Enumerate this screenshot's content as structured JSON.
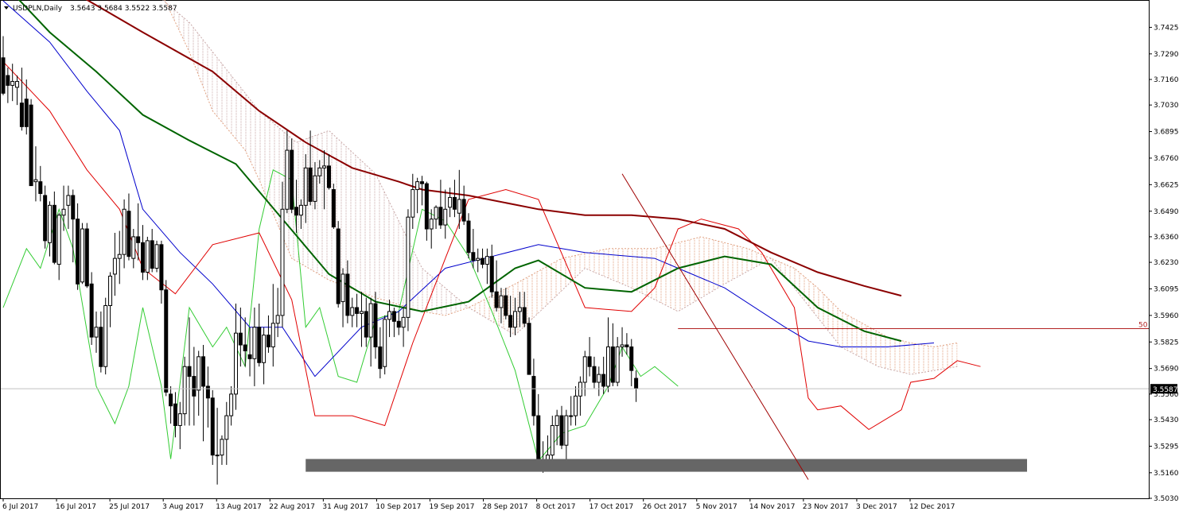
{
  "header": {
    "symbol": "USDPLN,Daily",
    "ohlc": "3.5643 3.5684 3.5522 3.5587"
  },
  "current_price_label": "3.5587",
  "fib_label": "50",
  "colors": {
    "bull_candle": "#ffffff",
    "bear_candle": "#000000",
    "ma_long": "#8b0000",
    "ma_mid": "#006400",
    "tenkan": "#e00000",
    "kijun": "#0000cc",
    "chikou": "#33cc33",
    "kumo_up": "#e0a080",
    "kumo_down": "#c8a8a8",
    "fib_line": "#b22222",
    "support_zone": "#666666"
  },
  "chart_data": {
    "type": "candlestick",
    "instrument": "USDPLN",
    "timeframe": "Daily",
    "last_ohlc": {
      "open": 3.5643,
      "high": 3.5684,
      "low": 3.5522,
      "close": 3.5587
    },
    "ylim": [
      3.503,
      3.756
    ],
    "y_ticks": [
      "3.7425",
      "3.7290",
      "3.7160",
      "3.7030",
      "3.6895",
      "3.6760",
      "3.6625",
      "3.6490",
      "3.6360",
      "3.6230",
      "3.6095",
      "3.5960",
      "3.5825",
      "3.5690",
      "3.5560",
      "3.5430",
      "3.5295",
      "3.5160",
      "3.5030"
    ],
    "x_ticks": [
      "6 Jul 2017",
      "16 Jul 2017",
      "25 Jul 2017",
      "3 Aug 2017",
      "13 Aug 2017",
      "22 Aug 2017",
      "31 Aug 2017",
      "10 Sep 2017",
      "19 Sep 2017",
      "28 Sep 2017",
      "8 Oct 2017",
      "17 Oct 2017",
      "26 Oct 2017",
      "5 Nov 2017",
      "14 Nov 2017",
      "23 Nov 2017",
      "3 Dec 2017",
      "12 Dec 2017"
    ],
    "candles": [
      [
        3.727,
        3.738,
        3.708,
        3.709
      ],
      [
        3.718,
        3.722,
        3.704,
        3.713
      ],
      [
        3.713,
        3.724,
        3.705,
        3.715
      ],
      [
        3.712,
        3.718,
        3.703,
        3.715
      ],
      [
        3.704,
        3.722,
        3.69,
        3.692
      ],
      [
        3.706,
        3.716,
        3.688,
        3.692
      ],
      [
        3.703,
        3.706,
        3.662,
        3.662
      ],
      [
        3.664,
        3.682,
        3.654,
        3.665
      ],
      [
        3.664,
        3.672,
        3.654,
        3.658
      ],
      [
        3.657,
        3.662,
        3.63,
        3.634
      ],
      [
        3.633,
        3.654,
        3.626,
        3.652
      ],
      [
        3.652,
        3.659,
        3.622,
        3.623
      ],
      [
        3.622,
        3.648,
        3.614,
        3.647
      ],
      [
        3.647,
        3.662,
        3.639,
        3.65
      ],
      [
        3.652,
        3.662,
        3.64,
        3.657
      ],
      [
        3.657,
        3.66,
        3.623,
        3.645
      ],
      [
        3.645,
        3.653,
        3.609,
        3.612
      ],
      [
        3.613,
        3.643,
        3.612,
        3.64
      ],
      [
        3.64,
        3.643,
        3.61,
        3.611
      ],
      [
        3.612,
        3.618,
        3.581,
        3.585
      ],
      [
        3.585,
        3.598,
        3.577,
        3.59
      ],
      [
        3.59,
        3.598,
        3.567,
        3.57
      ],
      [
        3.57,
        3.605,
        3.566,
        3.601
      ],
      [
        3.601,
        3.618,
        3.59,
        3.616
      ],
      [
        3.617,
        3.638,
        3.606,
        3.625
      ],
      [
        3.625,
        3.639,
        3.612,
        3.627
      ],
      [
        3.627,
        3.655,
        3.62,
        3.65
      ],
      [
        3.649,
        3.658,
        3.624,
        3.626
      ],
      [
        3.625,
        3.64,
        3.62,
        3.636
      ],
      [
        3.636,
        3.653,
        3.624,
        3.633
      ],
      [
        3.633,
        3.642,
        3.614,
        3.618
      ],
      [
        3.618,
        3.636,
        3.614,
        3.634
      ],
      [
        3.634,
        3.64,
        3.618,
        3.62
      ],
      [
        3.62,
        3.634,
        3.618,
        3.632
      ],
      [
        3.632,
        3.634,
        3.602,
        3.609
      ],
      [
        3.609,
        3.614,
        3.555,
        3.557
      ],
      [
        3.556,
        3.56,
        3.541,
        3.55
      ],
      [
        3.551,
        3.557,
        3.534,
        3.54
      ],
      [
        3.54,
        3.552,
        3.528,
        3.546
      ],
      [
        3.546,
        3.575,
        3.54,
        3.57
      ],
      [
        3.57,
        3.595,
        3.54,
        3.565
      ],
      [
        3.565,
        3.58,
        3.54,
        3.555
      ],
      [
        3.558,
        3.578,
        3.545,
        3.575
      ],
      [
        3.575,
        3.581,
        3.532,
        3.56
      ],
      [
        3.56,
        3.57,
        3.539,
        3.554
      ],
      [
        3.554,
        3.558,
        3.52,
        3.525
      ],
      [
        3.525,
        3.549,
        3.51,
        3.525
      ],
      [
        3.525,
        3.535,
        3.52,
        3.533
      ],
      [
        3.533,
        3.552,
        3.52,
        3.545
      ],
      [
        3.545,
        3.56,
        3.54,
        3.556
      ],
      [
        3.556,
        3.602,
        3.548,
        3.587
      ],
      [
        3.587,
        3.6,
        3.57,
        3.581
      ],
      [
        3.581,
        3.595,
        3.57,
        3.578
      ],
      [
        3.576,
        3.59,
        3.565,
        3.574
      ],
      [
        3.574,
        3.6,
        3.56,
        3.59
      ],
      [
        3.59,
        3.602,
        3.57,
        3.572
      ],
      [
        3.572,
        3.59,
        3.561,
        3.586
      ],
      [
        3.586,
        3.596,
        3.577,
        3.58
      ],
      [
        3.58,
        3.612,
        3.57,
        3.592
      ],
      [
        3.592,
        3.61,
        3.585,
        3.596
      ],
      [
        3.596,
        3.664,
        3.59,
        3.65
      ],
      [
        3.65,
        3.69,
        3.648,
        3.68
      ],
      [
        3.68,
        3.686,
        3.648,
        3.65
      ],
      [
        3.651,
        3.665,
        3.638,
        3.647
      ],
      [
        3.647,
        3.655,
        3.64,
        3.652
      ],
      [
        3.652,
        3.678,
        3.643,
        3.671
      ],
      [
        3.671,
        3.69,
        3.652,
        3.654
      ],
      [
        3.654,
        3.674,
        3.65,
        3.667
      ],
      [
        3.667,
        3.675,
        3.663,
        3.671
      ],
      [
        3.671,
        3.68,
        3.65,
        3.672
      ],
      [
        3.672,
        3.678,
        3.66,
        3.661
      ],
      [
        3.66,
        3.663,
        3.64,
        3.641
      ],
      [
        3.64,
        3.644,
        3.6,
        3.602
      ],
      [
        3.603,
        3.62,
        3.59,
        3.617
      ],
      [
        3.617,
        3.624,
        3.592,
        3.596
      ],
      [
        3.596,
        3.605,
        3.59,
        3.6
      ],
      [
        3.6,
        3.607,
        3.59,
        3.597
      ],
      [
        3.597,
        3.608,
        3.58,
        3.598
      ],
      [
        3.598,
        3.605,
        3.58,
        3.585
      ],
      [
        3.585,
        3.605,
        3.57,
        3.602
      ],
      [
        3.602,
        3.608,
        3.574,
        3.58
      ],
      [
        3.58,
        3.59,
        3.564,
        3.569
      ],
      [
        3.57,
        3.596,
        3.566,
        3.594
      ],
      [
        3.594,
        3.604,
        3.585,
        3.598
      ],
      [
        3.598,
        3.6,
        3.585,
        3.593
      ],
      [
        3.593,
        3.598,
        3.586,
        3.59
      ],
      [
        3.59,
        3.6,
        3.58,
        3.595
      ],
      [
        3.595,
        3.65,
        3.588,
        3.646
      ],
      [
        3.646,
        3.668,
        3.64,
        3.66
      ],
      [
        3.66,
        3.666,
        3.648,
        3.664
      ],
      [
        3.664,
        3.667,
        3.652,
        3.663
      ],
      [
        3.663,
        3.664,
        3.634,
        3.64
      ],
      [
        3.64,
        3.65,
        3.63,
        3.645
      ],
      [
        3.645,
        3.652,
        3.64,
        3.651
      ],
      [
        3.651,
        3.665,
        3.64,
        3.642
      ],
      [
        3.642,
        3.66,
        3.635,
        3.65
      ],
      [
        3.651,
        3.661,
        3.646,
        3.656
      ],
      [
        3.656,
        3.665,
        3.646,
        3.65
      ],
      [
        3.648,
        3.67,
        3.64,
        3.655
      ],
      [
        3.655,
        3.662,
        3.642,
        3.644
      ],
      [
        3.644,
        3.648,
        3.625,
        3.628
      ],
      [
        3.628,
        3.64,
        3.62,
        3.624
      ],
      [
        3.624,
        3.63,
        3.618,
        3.625
      ],
      [
        3.625,
        3.63,
        3.62,
        3.622
      ],
      [
        3.622,
        3.63,
        3.612,
        3.626
      ],
      [
        3.626,
        3.632,
        3.605,
        3.608
      ],
      [
        3.608,
        3.624,
        3.598,
        3.6
      ],
      [
        3.6,
        3.61,
        3.592,
        3.606
      ],
      [
        3.606,
        3.61,
        3.594,
        3.596
      ],
      [
        3.596,
        3.606,
        3.585,
        3.59
      ],
      [
        3.59,
        3.605,
        3.586,
        3.598
      ],
      [
        3.598,
        3.608,
        3.59,
        3.6
      ],
      [
        3.6,
        3.608,
        3.59,
        3.592
      ],
      [
        3.592,
        3.595,
        3.568,
        3.566
      ],
      [
        3.565,
        3.574,
        3.54,
        3.545
      ],
      [
        3.545,
        3.556,
        3.524,
        3.522
      ],
      [
        3.52,
        3.532,
        3.516,
        3.522
      ],
      [
        3.522,
        3.535,
        3.518,
        3.525
      ],
      [
        3.525,
        3.545,
        3.52,
        3.54
      ],
      [
        3.54,
        3.548,
        3.53,
        3.545
      ],
      [
        3.545,
        3.55,
        3.528,
        3.53
      ],
      [
        3.53,
        3.548,
        3.518,
        3.545
      ],
      [
        3.545,
        3.555,
        3.54,
        3.545
      ],
      [
        3.545,
        3.56,
        3.54,
        3.555
      ],
      [
        3.555,
        3.565,
        3.545,
        3.562
      ],
      [
        3.562,
        3.578,
        3.555,
        3.575
      ],
      [
        3.575,
        3.585,
        3.565,
        3.57
      ],
      [
        3.57,
        3.575,
        3.559,
        3.562
      ],
      [
        3.562,
        3.57,
        3.555,
        3.566
      ],
      [
        3.566,
        3.575,
        3.556,
        3.56
      ],
      [
        3.56,
        3.595,
        3.557,
        3.58
      ],
      [
        3.58,
        3.592,
        3.56,
        3.562
      ],
      [
        3.562,
        3.585,
        3.56,
        3.58
      ],
      [
        3.58,
        3.59,
        3.575,
        3.581
      ],
      [
        3.581,
        3.587,
        3.576,
        3.58
      ],
      [
        3.58,
        3.584,
        3.56,
        3.568
      ],
      [
        3.564,
        3.568,
        3.552,
        3.559
      ]
    ],
    "ma_long": [
      [
        0,
        3.772
      ],
      [
        14,
        3.762
      ],
      [
        30,
        3.74
      ],
      [
        45,
        3.72
      ],
      [
        55,
        3.7
      ],
      [
        65,
        3.684
      ],
      [
        75,
        3.671
      ],
      [
        85,
        3.664
      ],
      [
        90,
        3.66
      ],
      [
        100,
        3.657
      ],
      [
        115,
        3.65
      ],
      [
        125,
        3.647
      ],
      [
        135,
        3.647
      ],
      [
        145,
        3.645
      ],
      [
        155,
        3.64
      ],
      [
        165,
        3.628
      ],
      [
        175,
        3.618
      ],
      [
        185,
        3.611
      ],
      [
        193,
        3.606
      ]
    ],
    "ma_mid": [
      [
        0,
        3.765
      ],
      [
        10,
        3.74
      ],
      [
        20,
        3.72
      ],
      [
        30,
        3.698
      ],
      [
        40,
        3.685
      ],
      [
        50,
        3.673
      ],
      [
        60,
        3.645
      ],
      [
        70,
        3.617
      ],
      [
        80,
        3.603
      ],
      [
        90,
        3.598
      ],
      [
        100,
        3.603
      ],
      [
        110,
        3.62
      ],
      [
        115,
        3.624
      ],
      [
        125,
        3.61
      ],
      [
        135,
        3.608
      ],
      [
        145,
        3.62
      ],
      [
        155,
        3.626
      ],
      [
        165,
        3.622
      ],
      [
        175,
        3.6
      ],
      [
        185,
        3.588
      ],
      [
        193,
        3.583
      ]
    ],
    "tenkan": [
      [
        0,
        3.725
      ],
      [
        10,
        3.7
      ],
      [
        18,
        3.67
      ],
      [
        25,
        3.65
      ],
      [
        30,
        3.62
      ],
      [
        37,
        3.607
      ],
      [
        45,
        3.632
      ],
      [
        55,
        3.638
      ],
      [
        62,
        3.604
      ],
      [
        67,
        3.545
      ],
      [
        75,
        3.545
      ],
      [
        82,
        3.54
      ],
      [
        88,
        3.582
      ],
      [
        95,
        3.625
      ],
      [
        100,
        3.655
      ],
      [
        108,
        3.66
      ],
      [
        115,
        3.655
      ],
      [
        125,
        3.6
      ],
      [
        135,
        3.598
      ],
      [
        140,
        3.61
      ],
      [
        145,
        3.64
      ],
      [
        150,
        3.645
      ],
      [
        158,
        3.64
      ],
      [
        163,
        3.628
      ],
      [
        170,
        3.6
      ],
      [
        173,
        3.554
      ],
      [
        175,
        3.548
      ],
      [
        180,
        3.55
      ],
      [
        186,
        3.538
      ],
      [
        193,
        3.548
      ],
      [
        195,
        3.562
      ],
      [
        200,
        3.564
      ],
      [
        205,
        3.573
      ],
      [
        210,
        3.57
      ]
    ],
    "kijun": [
      [
        0,
        3.756
      ],
      [
        10,
        3.735
      ],
      [
        18,
        3.71
      ],
      [
        25,
        3.69
      ],
      [
        30,
        3.65
      ],
      [
        38,
        3.628
      ],
      [
        45,
        3.612
      ],
      [
        53,
        3.59
      ],
      [
        60,
        3.59
      ],
      [
        67,
        3.565
      ],
      [
        77,
        3.59
      ],
      [
        85,
        3.598
      ],
      [
        95,
        3.62
      ],
      [
        105,
        3.626
      ],
      [
        115,
        3.632
      ],
      [
        125,
        3.628
      ],
      [
        140,
        3.625
      ],
      [
        145,
        3.62
      ],
      [
        155,
        3.61
      ],
      [
        168,
        3.59
      ],
      [
        173,
        3.583
      ],
      [
        180,
        3.58
      ],
      [
        190,
        3.58
      ],
      [
        200,
        3.582
      ]
    ],
    "chikou": [
      [
        0,
        3.6
      ],
      [
        5,
        3.63
      ],
      [
        8,
        3.62
      ],
      [
        12,
        3.65
      ],
      [
        15,
        3.63
      ],
      [
        20,
        3.56
      ],
      [
        24,
        3.541
      ],
      [
        27,
        3.56
      ],
      [
        30,
        3.6
      ],
      [
        34,
        3.56
      ],
      [
        36,
        3.523
      ],
      [
        40,
        3.6
      ],
      [
        45,
        3.58
      ],
      [
        48,
        3.59
      ],
      [
        52,
        3.57
      ],
      [
        55,
        3.64
      ],
      [
        58,
        3.67
      ],
      [
        62,
        3.665
      ],
      [
        65,
        3.59
      ],
      [
        68,
        3.6
      ],
      [
        72,
        3.565
      ],
      [
        76,
        3.562
      ],
      [
        80,
        3.594
      ],
      [
        85,
        3.598
      ],
      [
        90,
        3.65
      ],
      [
        95,
        3.644
      ],
      [
        100,
        3.626
      ],
      [
        105,
        3.598
      ],
      [
        110,
        3.568
      ],
      [
        115,
        3.522
      ],
      [
        120,
        3.536
      ],
      [
        125,
        3.54
      ],
      [
        130,
        3.56
      ],
      [
        133,
        3.58
      ],
      [
        137,
        3.565
      ],
      [
        140,
        3.57
      ],
      [
        145,
        3.56
      ]
    ],
    "kumo_a": [
      [
        30,
        3.78
      ],
      [
        40,
        3.73
      ],
      [
        45,
        3.7
      ],
      [
        52,
        3.68
      ],
      [
        55,
        3.665
      ],
      [
        62,
        3.625
      ],
      [
        70,
        3.614
      ],
      [
        80,
        3.605
      ],
      [
        90,
        3.598
      ],
      [
        95,
        3.596
      ],
      [
        100,
        3.6
      ],
      [
        110,
        3.612
      ],
      [
        120,
        3.625
      ],
      [
        130,
        3.63
      ],
      [
        140,
        3.63
      ],
      [
        150,
        3.636
      ],
      [
        160,
        3.63
      ],
      [
        170,
        3.62
      ],
      [
        175,
        3.61
      ],
      [
        180,
        3.598
      ],
      [
        190,
        3.585
      ],
      [
        195,
        3.582
      ],
      [
        200,
        3.58
      ],
      [
        205,
        3.582
      ]
    ],
    "kumo_b": [
      [
        30,
        3.765
      ],
      [
        40,
        3.745
      ],
      [
        55,
        3.7
      ],
      [
        63,
        3.684
      ],
      [
        70,
        3.69
      ],
      [
        80,
        3.668
      ],
      [
        90,
        3.62
      ],
      [
        100,
        3.6
      ],
      [
        110,
        3.586
      ],
      [
        118,
        3.604
      ],
      [
        125,
        3.62
      ],
      [
        135,
        3.61
      ],
      [
        145,
        3.598
      ],
      [
        155,
        3.612
      ],
      [
        165,
        3.625
      ],
      [
        175,
        3.595
      ],
      [
        180,
        3.58
      ],
      [
        188,
        3.57
      ],
      [
        195,
        3.566
      ],
      [
        200,
        3.568
      ],
      [
        205,
        3.57
      ]
    ],
    "fib_50_level": 3.5893,
    "support_zone": [
      3.5165,
      3.523
    ],
    "drawn_trendline": [
      [
        133,
        3.668
      ],
      [
        173,
        3.5125
      ]
    ]
  }
}
